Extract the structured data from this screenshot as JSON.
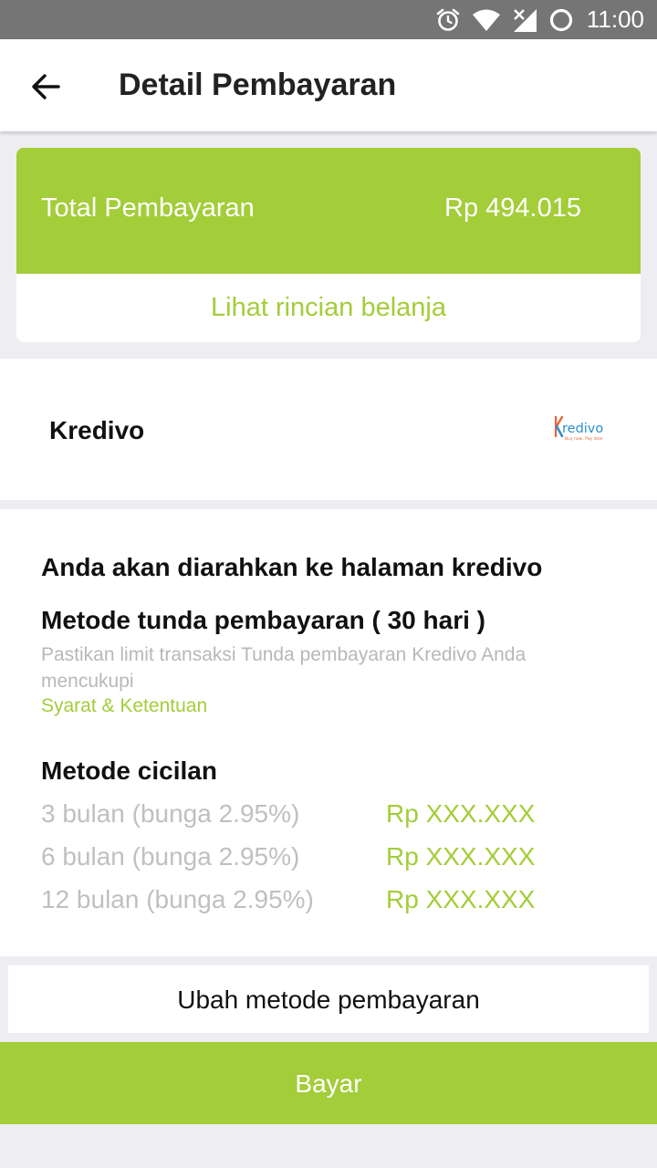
{
  "status_bar": {
    "time": "11:00"
  },
  "header": {
    "title": "Detail Pembayaran"
  },
  "total": {
    "label": "Total Pembayaran",
    "amount": "Rp 494.015",
    "details_link": "Lihat rincian belanja"
  },
  "method": {
    "name": "Kredivo",
    "logo_text": "redivo",
    "logo_tagline": "Buy now, Pay later"
  },
  "info": {
    "redirect": "Anda akan diarahkan ke halaman kredivo",
    "defer_title": "Metode tunda pembayaran ( 30 hari )",
    "defer_note": "Pastikan limit transaksi Tunda pembayaran Kredivo Anda mencukupi",
    "terms_link": "Syarat & Ketentuan",
    "installment_title": "Metode cicilan",
    "installments": [
      {
        "label": "3 bulan (bunga 2.95%)",
        "amount": "Rp XXX.XXX"
      },
      {
        "label": "6 bulan (bunga 2.95%)",
        "amount": "Rp XXX.XXX"
      },
      {
        "label": "12 bulan (bunga 2.95%)",
        "amount": "Rp XXX.XXX"
      }
    ]
  },
  "buttons": {
    "change_method": "Ubah metode pembayaran",
    "pay": "Bayar"
  },
  "colors": {
    "accent": "#a3cd39",
    "status_bar": "#757575",
    "background": "#eeeef2"
  },
  "icons": [
    "alarm-icon",
    "wifi-icon",
    "signal-icon",
    "battery-icon",
    "back-arrow-icon",
    "kredivo-logo"
  ]
}
